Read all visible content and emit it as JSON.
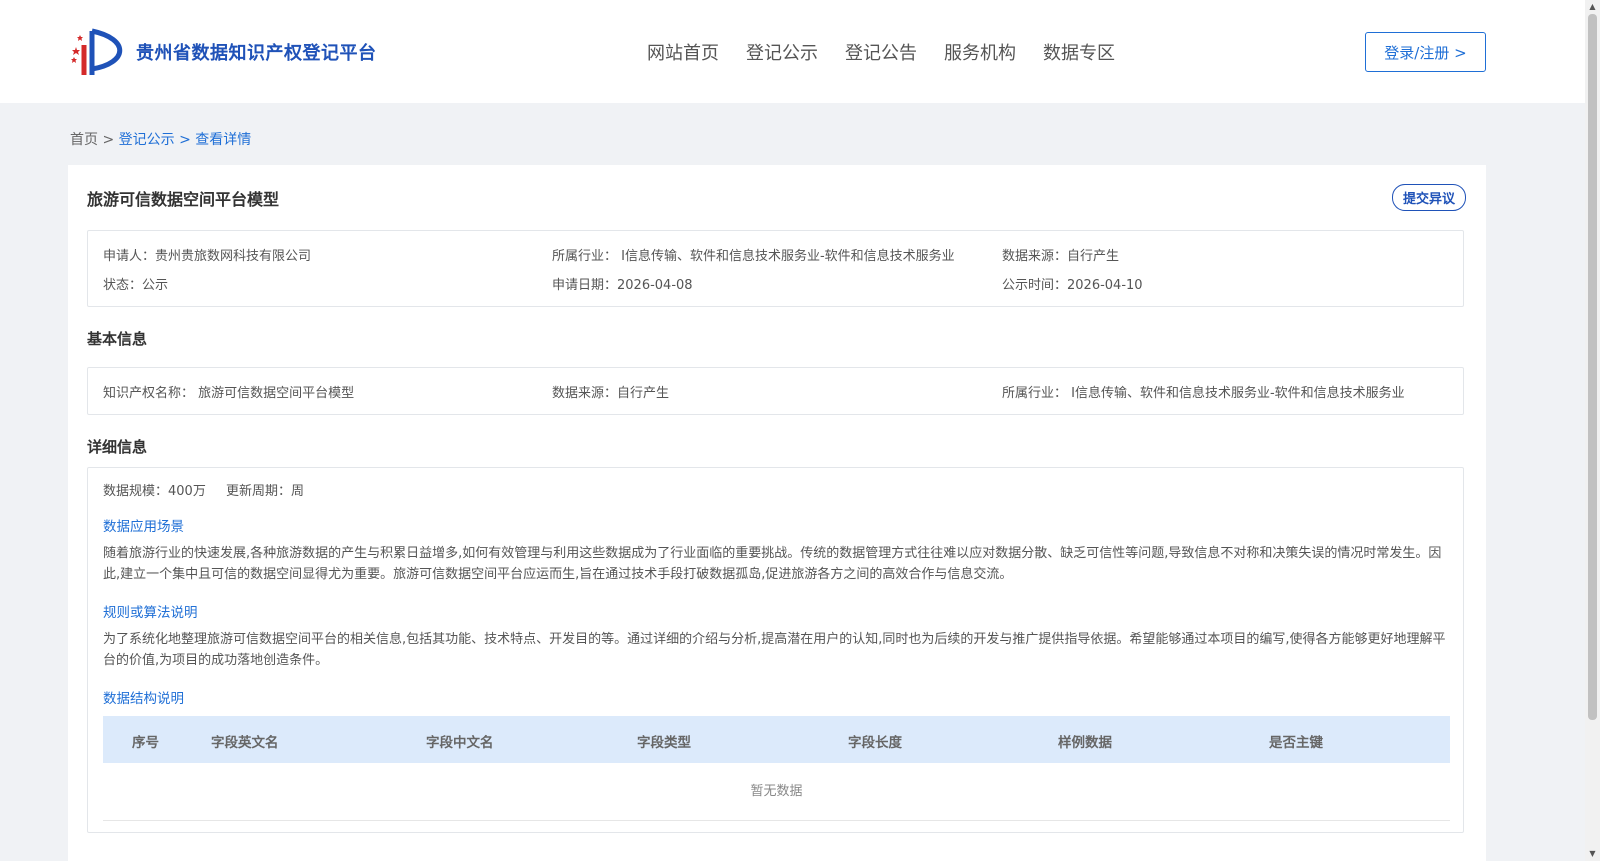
{
  "header": {
    "site_title": "贵州省数据知识产权登记平台",
    "nav": [
      "网站首页",
      "登记公示",
      "登记公告",
      "服务机构",
      "数据专区"
    ],
    "login_label": "登录/注册 >"
  },
  "breadcrumb": {
    "home": "首页 > ",
    "list": "登记公示 > ",
    "current": "查看详情"
  },
  "detail": {
    "title": "旅游可信数据空间平台模型",
    "objection_label": "提交异议",
    "summary": {
      "applicant": "申请人：贵州贵旅数网科技有限公司",
      "industry": "所属行业： I信息传输、软件和信息技术服务业-软件和信息技术服务业",
      "source": "数据来源：自行产生",
      "status": "状态：公示",
      "apply_date": "申请日期：2026-04-08",
      "publicity_date": "公示时间：2026-04-10"
    },
    "basic_title": "基本信息",
    "basic": {
      "ip_name": "知识产权名称： 旅游可信数据空间平台模型",
      "source": "数据来源：自行产生",
      "industry": "所属行业： I信息传输、软件和信息技术服务业-软件和信息技术服务业"
    },
    "detail_title": "详细信息",
    "scale": "数据规模：400万",
    "update_cycle": "更新周期：周",
    "scenario_title": "数据应用场景",
    "scenario_text": "随着旅游行业的快速发展,各种旅游数据的产生与积累日益增多,如何有效管理与利用这些数据成为了行业面临的重要挑战。传统的数据管理方式往往难以应对数据分散、缺乏可信性等问题,导致信息不对称和决策失误的情况时常发生。因此,建立一个集中且可信的数据空间显得尤为重要。旅游可信数据空间平台应运而生,旨在通过技术手段打破数据孤岛,促进旅游各方之间的高效合作与信息交流。",
    "rules_title": "规则或算法说明",
    "rules_text": "为了系统化地整理旅游可信数据空间平台的相关信息,包括其功能、技术特点、开发目的等。通过详细的介绍与分析,提高潜在用户的认知,同时也为后续的开发与推广提供指导依据。希望能够通过本项目的编写,使得各方能够更好地理解平台的价值,为项目的成功落地创造条件。",
    "structure_title": "数据结构说明",
    "table_headers": [
      "序号",
      "字段英文名",
      "字段中文名",
      "字段类型",
      "字段长度",
      "样例数据",
      "是否主键"
    ],
    "empty_text": "暂无数据"
  },
  "colors": {
    "brand": "#1f52b8",
    "link": "#1f6fd6",
    "table_header_bg": "#dceafb",
    "page_bg": "#f0f2f5"
  }
}
